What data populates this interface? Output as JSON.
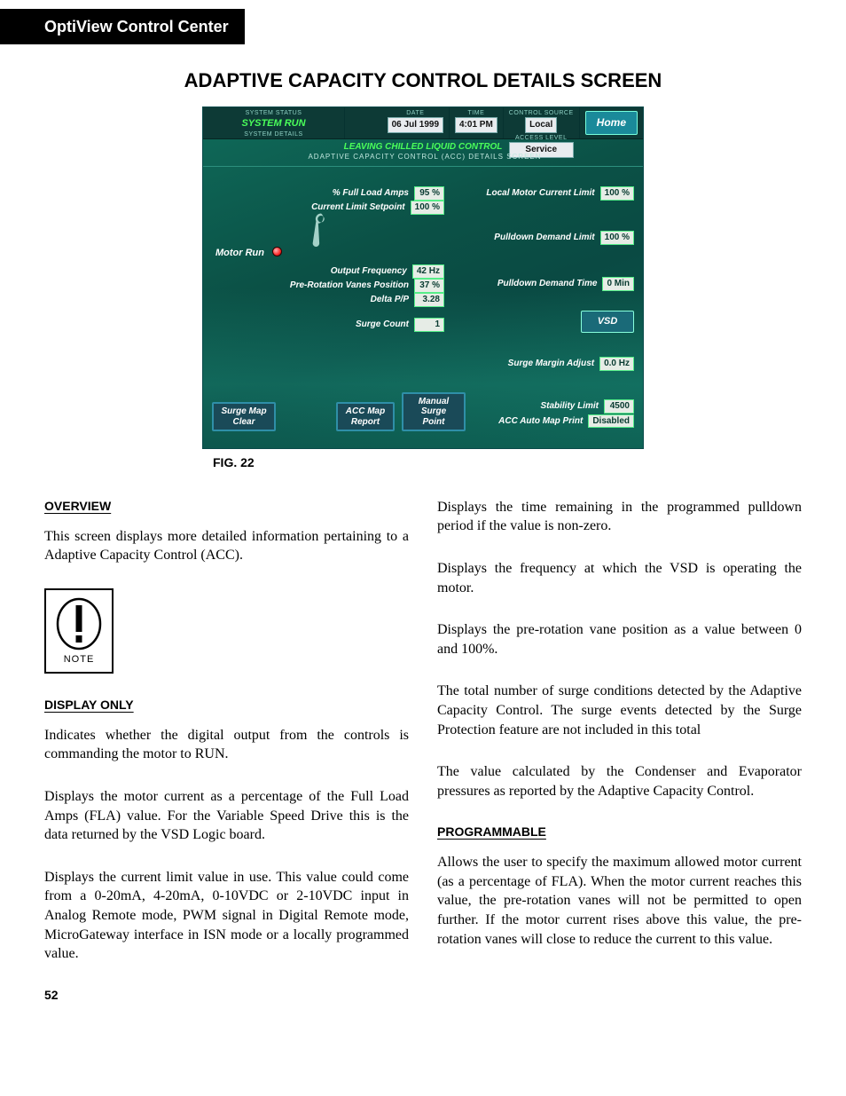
{
  "header": {
    "title": "OptiView Control Center"
  },
  "page_title": "ADAPTIVE CAPACITY CONTROL DETAILS SCREEN",
  "figure": {
    "caption": "FIG. 22"
  },
  "hmi": {
    "top": {
      "system_status_label": "SYSTEM STATUS",
      "system_status": "SYSTEM RUN",
      "system_details_label": "SYSTEM DETAILS",
      "date_label": "DATE",
      "date": "06 Jul 1999",
      "time_label": "TIME",
      "time": "4:01 PM",
      "control_source_label": "CONTROL SOURCE",
      "control_source": "Local",
      "access_level_label": "ACCESS LEVEL",
      "access_level": "Service",
      "home": "Home"
    },
    "subheader": "LEAVING CHILLED LIQUID CONTROL",
    "breadcrumb": "ADAPTIVE CAPACITY CONTROL (ACC) DETAILS SCREEN",
    "motor_run": "Motor Run",
    "fields_left": [
      {
        "label": "% Full Load Amps",
        "value": "95 %"
      },
      {
        "label": "Current Limit Setpoint",
        "value": "100 %"
      },
      {
        "label": "Output Frequency",
        "value": "42 Hz"
      },
      {
        "label": "Pre-Rotation Vanes Position",
        "value": "37 %"
      },
      {
        "label": "Delta P/P",
        "value": "3.28"
      },
      {
        "label": "Surge Count",
        "value": "1"
      }
    ],
    "fields_right": [
      {
        "label": "Local Motor Current Limit",
        "value": "100 %"
      },
      {
        "label": "Pulldown Demand Limit",
        "value": "100 %"
      },
      {
        "label": "Pulldown Demand Time",
        "value": "0 Min"
      },
      {
        "label": "Surge Margin Adjust",
        "value": "0.0 Hz"
      },
      {
        "label": "Stability Limit",
        "value": "4500"
      },
      {
        "label": "ACC Auto Map Print",
        "value": "Disabled"
      }
    ],
    "vsd_button": "VSD",
    "footer_buttons": {
      "surge_map_clear": "Surge Map\nClear",
      "acc_map_report": "ACC Map\nReport",
      "manual_surge_point": "Manual\nSurge Point"
    }
  },
  "note": {
    "label": "NOTE"
  },
  "sections": {
    "overview_head": "OVERVIEW",
    "overview_p1": "This screen displays more detailed information pertaining to a Adaptive Capacity Control (ACC).",
    "display_only_head": "DISPLAY ONLY",
    "display_only_p1": "Indicates whether the digital output from the controls is commanding the motor to RUN.",
    "display_only_p2": "Displays the motor current as a percentage of the Full Load Amps (FLA) value. For the Variable Speed Drive this is the data returned by the VSD Logic board.",
    "display_only_p3": "Displays the current limit value in use. This value could come from a 0-20mA, 4-20mA, 0-10VDC or 2-10VDC input in Analog Remote mode, PWM signal in Digital Remote mode, MicroGateway interface in ISN mode or a locally programmed value.",
    "right_p1": "Displays the time remaining in the programmed pulldown period if the value is non-zero.",
    "right_p2": "Displays the frequency at which the VSD is operating the motor.",
    "right_p3": "Displays the pre-rotation vane position as a value between 0 and 100%.",
    "right_p4": "The total number of surge conditions detected by the Adaptive Capacity Control. The surge events detected by the Surge Protection feature are not included in this total",
    "right_p5": "The value calculated by the Condenser and Evaporator pressures as reported by the Adaptive Capacity Control.",
    "programmable_head": "PROGRAMMABLE",
    "programmable_p1": "Allows the user to specify the maximum allowed motor current (as a percentage of FLA). When the motor current reaches this value, the pre-rotation vanes will not be permitted to open further. If the motor current rises above this value, the pre-rotation vanes will close to reduce the current to this value."
  },
  "page_number": "52"
}
